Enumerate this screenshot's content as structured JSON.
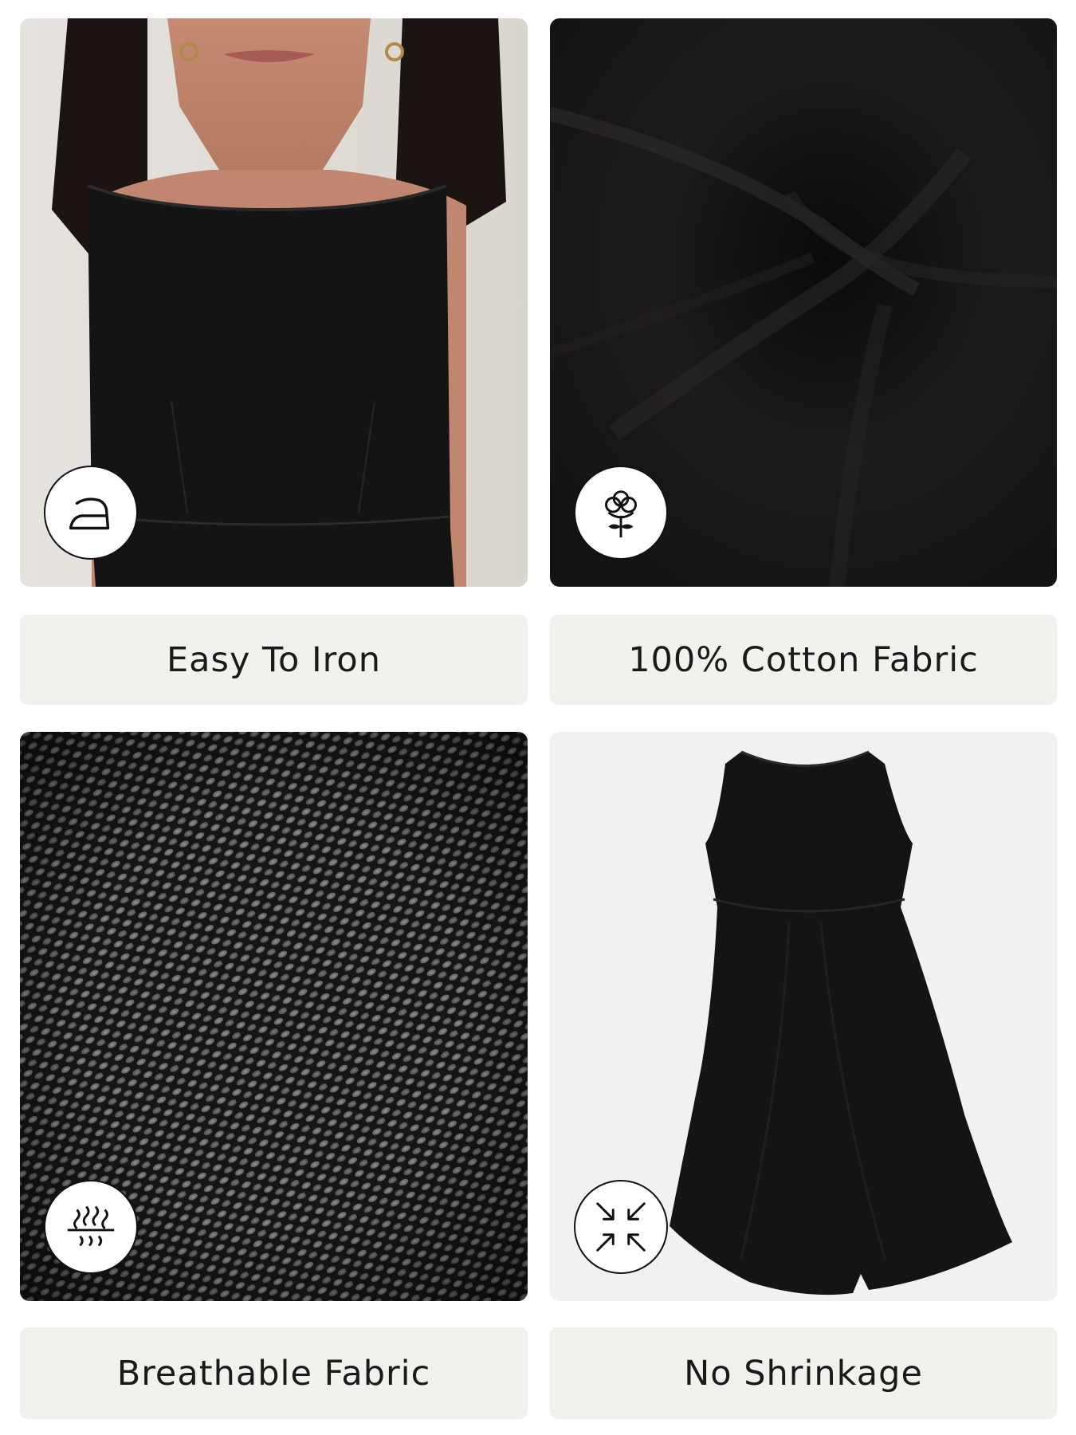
{
  "features": [
    {
      "label": "Easy To Iron",
      "icon": "iron-icon"
    },
    {
      "label": "100% Cotton Fabric",
      "icon": "cotton-flower-icon"
    },
    {
      "label": "Breathable Fabric",
      "icon": "breathable-icon"
    },
    {
      "label": "No Shrinkage",
      "icon": "no-shrink-icon"
    }
  ],
  "colors": {
    "label_bg": "#f2f1ee",
    "label_text": "#1a1a1a",
    "fabric": "#121212",
    "backdrop": "#f1f1f1"
  }
}
